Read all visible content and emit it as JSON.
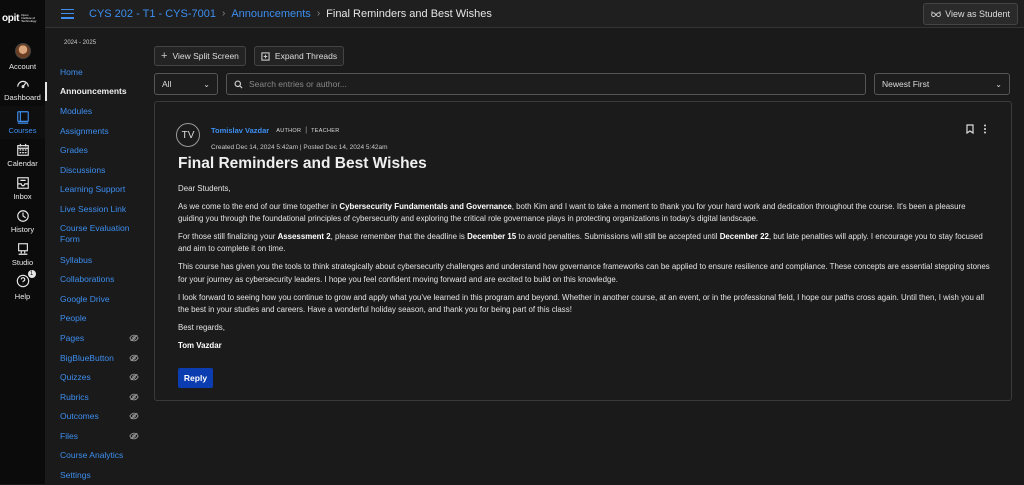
{
  "brand": {
    "logo_text": "opit",
    "logo_sub": "Open Institute of Technology"
  },
  "global_nav": [
    {
      "label": "Account",
      "icon": "avatar"
    },
    {
      "label": "Dashboard",
      "icon": "dashboard-icon"
    },
    {
      "label": "Courses",
      "icon": "courses-icon",
      "active": true
    },
    {
      "label": "Calendar",
      "icon": "calendar-icon"
    },
    {
      "label": "Inbox",
      "icon": "inbox-icon"
    },
    {
      "label": "History",
      "icon": "history-icon"
    },
    {
      "label": "Studio",
      "icon": "studio-icon"
    },
    {
      "label": "Help",
      "icon": "help-icon",
      "badge": "1"
    }
  ],
  "header": {
    "breadcrumb": [
      "CYS 202 - T1 - CYS-7001",
      "Announcements",
      "Final Reminders and Best Wishes"
    ],
    "view_as_student": "View as Student"
  },
  "course_nav": {
    "term": "2024 - 2025",
    "items": [
      {
        "label": "Home"
      },
      {
        "label": "Announcements",
        "active": true
      },
      {
        "label": "Modules"
      },
      {
        "label": "Assignments"
      },
      {
        "label": "Grades"
      },
      {
        "label": "Discussions"
      },
      {
        "label": "Learning Support"
      },
      {
        "label": "Live Session Link"
      },
      {
        "label": "Course Evaluation Form"
      },
      {
        "label": "Syllabus"
      },
      {
        "label": "Collaborations"
      },
      {
        "label": "Google Drive"
      },
      {
        "label": "People"
      },
      {
        "label": "Pages",
        "hidden": true
      },
      {
        "label": "BigBlueButton",
        "hidden": true
      },
      {
        "label": "Quizzes",
        "hidden": true
      },
      {
        "label": "Rubrics",
        "hidden": true
      },
      {
        "label": "Outcomes",
        "hidden": true
      },
      {
        "label": "Files",
        "hidden": true
      },
      {
        "label": "Course Analytics"
      },
      {
        "label": "Settings"
      }
    ]
  },
  "toolbar": {
    "split_screen": "View Split Screen",
    "expand_threads": "Expand Threads",
    "filter_value": "All",
    "search_placeholder": "Search entries or author...",
    "sort_value": "Newest First"
  },
  "post": {
    "avatar_initials": "TV",
    "author": "Tomislav Vazdar",
    "role_author": "AUTHOR",
    "role_teacher": "TEACHER",
    "dates": "Created Dec 14, 2024 5:42am | Posted Dec 14, 2024 5:42am",
    "title": "Final Reminders and Best Wishes",
    "greeting": "Dear Students,",
    "p1_a": "As we come to the end of our time together in ",
    "p1_b": "Cybersecurity Fundamentals and Governance",
    "p1_c": ", both Kim and I want to take a moment to thank you for your hard work and dedication throughout the course. It's been a pleasure guiding you through the foundational principles of cybersecurity and exploring the critical role governance plays in protecting organizations in today's digital landscape.",
    "p2_a": "For those still finalizing your ",
    "p2_b": "Assessment 2",
    "p2_c": ", please remember that the deadline is ",
    "p2_d": "December 15",
    "p2_e": " to avoid penalties. Submissions will still be accepted until ",
    "p2_f": "December 22",
    "p2_g": ", but late penalties will apply. I encourage you to stay focused and aim to complete it on time.",
    "p3": "This course has given you the tools to think strategically about cybersecurity challenges and understand how governance frameworks can be applied to ensure resilience and compliance. These concepts are essential stepping stones for your journey as cybersecurity leaders. I hope you feel confident moving forward and are excited to build on this knowledge.",
    "p4": "I look forward to seeing how you continue to grow and apply what you've learned in this program and beyond. Whether in another course, at an event, or in the professional field, I hope our paths cross again. Until then, I wish you all the best in your studies and careers. Have a wonderful holiday season, and thank you for being part of this class!",
    "closing": "Best regards,",
    "signature": "Tom Vazdar",
    "reply_label": "Reply"
  }
}
